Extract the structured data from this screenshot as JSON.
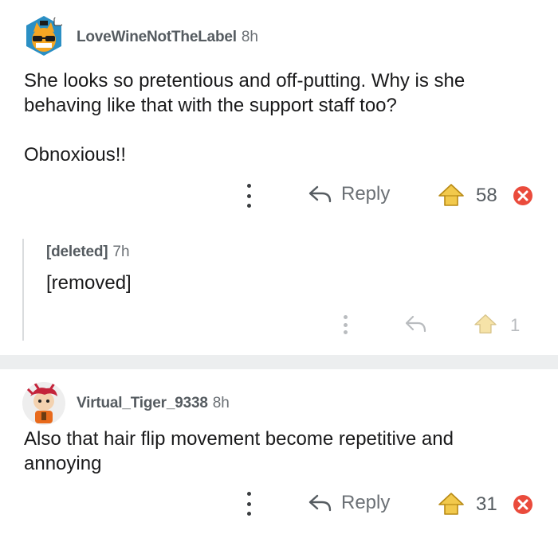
{
  "comments": [
    {
      "username": "LoveWineNotTheLabel",
      "time": "8h",
      "body": "She looks so pretentious and off-putting. Why is she behaving like that with the support staff too?\n\nObnoxious!!",
      "reply_label": "Reply",
      "votes": "58",
      "avatar_icon": "cat-sunglasses-avatar-icon"
    },
    {
      "username": "[deleted]",
      "time": "7h",
      "body": "[removed]",
      "votes": "1"
    },
    {
      "username": "Virtual_Tiger_9338",
      "time": "8h",
      "body": "Also that hair flip movement become repetitive and annoying",
      "reply_label": "Reply",
      "votes": "31",
      "avatar_icon": "red-hair-character-avatar-icon"
    }
  ],
  "colors": {
    "award_gold": "#f2c94c",
    "downvote_red": "#ea4b3c",
    "divider": "#eceeef",
    "avatar_blue": "#2b8fc4"
  }
}
